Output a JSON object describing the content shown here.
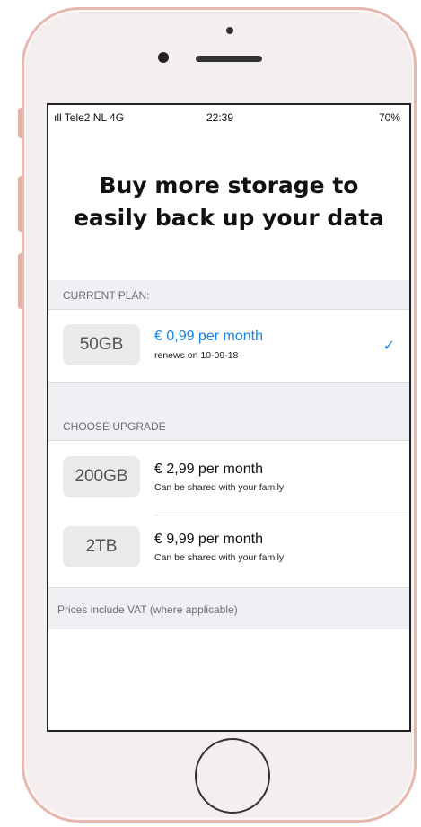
{
  "status_bar": {
    "carrier": "ıll Tele2 NL  4G",
    "time": "22:39",
    "battery": "70%"
  },
  "headline": {
    "line1": "Buy more storage to",
    "line2": "easily back up your data"
  },
  "current_plan": {
    "header": "CURRENT PLAN:",
    "size": "50GB",
    "price": "€ 0,99 per month",
    "detail": "renews on 10-09-18",
    "check_icon": "✓"
  },
  "upgrade": {
    "header": "CHOOSE UPGRADE",
    "options": [
      {
        "size": "200GB",
        "price": "€ 2,99 per month",
        "detail": "Can be shared with your family"
      },
      {
        "size": "2TB",
        "price": "€ 9,99 per month",
        "detail": "Can be shared with your family"
      }
    ]
  },
  "footer_note": "Prices include VAT (where applicable)",
  "colors": {
    "accent": "#1a82e2",
    "section_bg": "#efeff4",
    "phone_frame": "#e6b8b0"
  }
}
